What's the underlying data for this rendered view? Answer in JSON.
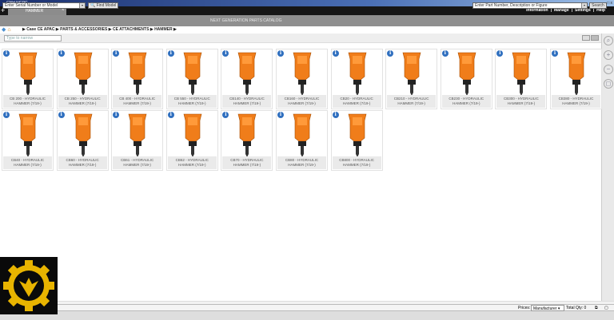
{
  "window": {
    "title": "CNH NGPC",
    "controls": "_ □ x"
  },
  "tabs": [
    {
      "label": "HAMMER",
      "close": "x"
    }
  ],
  "topmenu": [
    "Information",
    "Manage",
    "Settings",
    "Help"
  ],
  "toolbar": {
    "serial_placeholder": "Enter Serial Number or Model",
    "find_model": "Find Model",
    "catalog_title": "NEXT GENERATION PARTS CATALOG",
    "part_placeholder": "Enter Part Number, Description or Figure",
    "search": "Search"
  },
  "breadcrumb": [
    "Case CE APAC",
    "PARTS & ACCESSORIES",
    "CE ATTACHMENTS",
    "HAMMER"
  ],
  "filter": {
    "placeholder": "Type to narrow"
  },
  "items": [
    {
      "label": "CB 200 - HYDRAULIC HAMMER (7/19-)"
    },
    {
      "label": "CB 250 - HYDRAULIC HAMMER (7/19-)"
    },
    {
      "label": "CB 400 - HYDRAULIC HAMMER (7/19-)"
    },
    {
      "label": "CB 550 - HYDRAULIC HAMMER (7/19-)"
    },
    {
      "label": "CB140 - HYDRAULIC HAMMER (7/19-)"
    },
    {
      "label": "CB160 - HYDRAULIC HAMMER (7/19-)"
    },
    {
      "label": "CB20 - HYDRAULIC HAMMER (7/19-)"
    },
    {
      "label": "CB210 - HYDRAULIC HAMMER (7/19-)"
    },
    {
      "label": "CB230 - HYDRAULIC HAMMER (7/19-)"
    },
    {
      "label": "CB300 - HYDRAULIC HAMMER (7/19-)"
    },
    {
      "label": "CB380 - HYDRAULIC HAMMER (7/19-)"
    },
    {
      "label": "CB40 - HYDRAULIC HAMMER (7/19-)"
    },
    {
      "label": "CB60 - HYDRAULIC HAMMER (7/19-)"
    },
    {
      "label": "CB61 - HYDRAULIC HAMMER (7/19-)"
    },
    {
      "label": "CB62 - HYDRAULIC HAMMER (7/19-)"
    },
    {
      "label": "CB70 - HYDRAULIC HAMMER (7/19-)"
    },
    {
      "label": "CB80 - HYDRAULIC HAMMER (7/19-)"
    },
    {
      "label": "CB800 - HYDRAULIC HAMMER (7/19-)"
    }
  ],
  "status": {
    "prices_label": "Prices:",
    "prices_value": "Manufacturer",
    "total_qty": "Total Qty: 0"
  },
  "colors": {
    "accent": "#f07d1a",
    "info": "#2f6fbf"
  }
}
